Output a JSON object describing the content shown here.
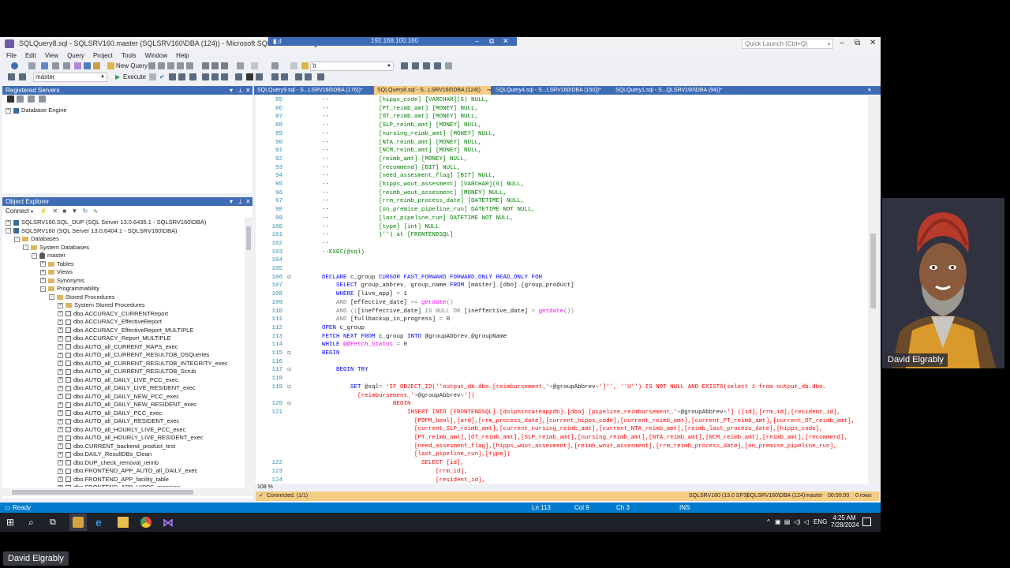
{
  "window": {
    "title": "SQLQuery8.sql - SQLSRV160.master (SQLSRV160\\DBA (124)) - Microsoft SQL Server Management Studio",
    "remote_ip": "192.168.100.160",
    "quick_launch_placeholder": "Quick Launch (Ctrl+Q)"
  },
  "menu": [
    "File",
    "Edit",
    "View",
    "Query",
    "Project",
    "Tools",
    "Window",
    "Help"
  ],
  "toolbar": {
    "new_query": "New Query",
    "execute": "Execute",
    "database": "master",
    "search_box": "\\t"
  },
  "registered_servers": {
    "title": "Registered Servers",
    "items": [
      {
        "label": "Database Engine"
      }
    ]
  },
  "object_explorer": {
    "title": "Object Explorer",
    "connect": "Connect",
    "servers": [
      {
        "label": "SQLSRV160.SQL_DUP (SQL Server 13.0.6435.1 - SQLSRV160\\DBA)"
      },
      {
        "label": "SQLSRV160 (SQL Server 13.0.6404.1 - SQLSRV160\\DBA)"
      }
    ],
    "tree": [
      {
        "label": "Databases",
        "level": 1,
        "type": "folder",
        "exp": "-"
      },
      {
        "label": "System Databases",
        "level": 2,
        "type": "folder",
        "exp": "-"
      },
      {
        "label": "master",
        "level": 3,
        "type": "db",
        "exp": "-"
      },
      {
        "label": "Tables",
        "level": 4,
        "type": "folder",
        "exp": "+"
      },
      {
        "label": "Views",
        "level": 4,
        "type": "folder",
        "exp": "+"
      },
      {
        "label": "Synonyms",
        "level": 4,
        "type": "folder",
        "exp": "+"
      },
      {
        "label": "Programmability",
        "level": 4,
        "type": "folder",
        "exp": "-"
      },
      {
        "label": "Stored Procedures",
        "level": 5,
        "type": "folder",
        "exp": "-"
      },
      {
        "label": "System Stored Procedures",
        "level": 6,
        "type": "folder",
        "exp": "+"
      },
      {
        "label": "dbo.ACCURACY_CURRENTReport",
        "level": 6,
        "type": "proc",
        "exp": "+"
      },
      {
        "label": "dbo.ACCURACY_EffectiveReport",
        "level": 6,
        "type": "proc",
        "exp": "+"
      },
      {
        "label": "dbo.ACCURACY_EffectiveReport_MULTIPLE",
        "level": 6,
        "type": "proc",
        "exp": "+"
      },
      {
        "label": "dbo.ACCURACY_Report_MULTIPLE",
        "level": 6,
        "type": "proc",
        "exp": "+"
      },
      {
        "label": "dbo.AUTO_all_CURRENT_RAPS_exec",
        "level": 6,
        "type": "proc",
        "exp": "+"
      },
      {
        "label": "dbo.AUTO_all_CURRENT_RESULTDB_DSQueries",
        "level": 6,
        "type": "proc",
        "exp": "+"
      },
      {
        "label": "dbo.AUTO_all_CURRENT_RESULTDB_INTEGRITY_exec",
        "level": 6,
        "type": "proc",
        "exp": "+"
      },
      {
        "label": "dbo.AUTO_all_CURRENT_RESULTDB_Scrub",
        "level": 6,
        "type": "proc",
        "exp": "+"
      },
      {
        "label": "dbo.AUTO_all_DAILY_LIVE_PCC_exec",
        "level": 6,
        "type": "proc",
        "exp": "+"
      },
      {
        "label": "dbo.AUTO_all_DAILY_LIVE_RESIDENT_exec",
        "level": 6,
        "type": "proc",
        "exp": "+"
      },
      {
        "label": "dbo.AUTO_all_DAILY_NEW_PCC_exec",
        "level": 6,
        "type": "proc",
        "exp": "+"
      },
      {
        "label": "dbo.AUTO_all_DAILY_NEW_RESIDENT_exec",
        "level": 6,
        "type": "proc",
        "exp": "+"
      },
      {
        "label": "dbo.AUTO_all_DAILY_PCC_exec",
        "level": 6,
        "type": "proc",
        "exp": "+"
      },
      {
        "label": "dbo.AUTO_all_DAILY_RESIDENT_exec",
        "level": 6,
        "type": "proc",
        "exp": "+"
      },
      {
        "label": "dbo.AUTO_all_HOURLY_LIVE_PCC_exec",
        "level": 6,
        "type": "proc",
        "exp": "+"
      },
      {
        "label": "dbo.AUTO_all_HOURLY_LIVE_RESIDENT_exec",
        "level": 6,
        "type": "proc",
        "exp": "+"
      },
      {
        "label": "dbo.CURRENT_backend_product_test",
        "level": 6,
        "type": "proc",
        "exp": "+"
      },
      {
        "label": "dbo.DAILY_ResultDBs_Clean",
        "level": 6,
        "type": "proc",
        "exp": "+"
      },
      {
        "label": "dbo.DUP_check_removal_reimb",
        "level": 6,
        "type": "proc",
        "exp": "+"
      },
      {
        "label": "dbo.FRONTEND_APP_AUTO_all_DAILY_exec",
        "level": 6,
        "type": "proc",
        "exp": "+"
      },
      {
        "label": "dbo.FRONTEND_APP_facility_table",
        "level": 6,
        "type": "proc",
        "exp": "+"
      },
      {
        "label": "dbo.FRONTEND_APP_HIPPS_mapping",
        "level": 6,
        "type": "proc",
        "exp": "+"
      }
    ]
  },
  "tabs": [
    {
      "label": "SQLQuery9.sql - S...LSRV160\\DBA (176))*",
      "active": false
    },
    {
      "label": "SQLQuery8.sql - S...LSRV160\\DBA (124))",
      "active": true
    },
    {
      "label": "SQLQuery4.sql - S...LSRV160\\DBA (150))*",
      "active": false
    },
    {
      "label": "SQLQuery1.sql - S...QLSRV160\\DBA (94))*",
      "active": false
    }
  ],
  "editor": {
    "zoom": "108 %",
    "lines": [
      {
        "n": "85",
        "segs": [
          [
            "cm",
            "        --              [hipps_code] [VARCHAR](6) NULL,"
          ]
        ]
      },
      {
        "n": "86",
        "segs": [
          [
            "cm",
            "        --              [PT_reimb_amt] [MONEY] NULL,"
          ]
        ]
      },
      {
        "n": "87",
        "segs": [
          [
            "cm",
            "        --              [OT_reimb_amt] [MONEY] NULL,"
          ]
        ]
      },
      {
        "n": "88",
        "segs": [
          [
            "cm",
            "        --              [SLP_reimb_amt] [MONEY] NULL,"
          ]
        ]
      },
      {
        "n": "89",
        "segs": [
          [
            "cm",
            "        --              [nursing_reimb_amt] [MONEY] NULL,"
          ]
        ]
      },
      {
        "n": "90",
        "segs": [
          [
            "cm",
            "        --              [NTA_reimb_amt] [MONEY] NULL,"
          ]
        ]
      },
      {
        "n": "91",
        "segs": [
          [
            "cm",
            "        --              [NCM_reimb_amt] [MONEY] NULL,"
          ]
        ]
      },
      {
        "n": "92",
        "segs": [
          [
            "cm",
            "        --              [reimb_amt] [MONEY] NULL,"
          ]
        ]
      },
      {
        "n": "93",
        "segs": [
          [
            "cm",
            "        --              [recommend] [BIT] NULL,"
          ]
        ]
      },
      {
        "n": "94",
        "segs": [
          [
            "cm",
            "        --              [need_assesment_flag] [BIT] NULL,"
          ]
        ]
      },
      {
        "n": "95",
        "segs": [
          [
            "cm",
            "        --              [hipps_wout_assesment] [VARCHAR](6) NULL,"
          ]
        ]
      },
      {
        "n": "96",
        "segs": [
          [
            "cm",
            "        --              [reimb_wout_assesment] [MONEY] NULL,"
          ]
        ]
      },
      {
        "n": "97",
        "segs": [
          [
            "cm",
            "        --              [rrm_reimb_process_date] [DATETIME] NULL,"
          ]
        ]
      },
      {
        "n": "98",
        "segs": [
          [
            "cm",
            "        --              [on_premise_pipeline_run] DATETIME NOT NULL,"
          ]
        ]
      },
      {
        "n": "99",
        "segs": [
          [
            "cm",
            "        --              [last_pipeline_run] DATETIME NOT NULL,"
          ]
        ]
      },
      {
        "n": "100",
        "segs": [
          [
            "cm",
            "        --              [type] [int] NULL"
          ]
        ]
      },
      {
        "n": "101",
        "segs": [
          [
            "cm",
            "        --              )'') at [FRONTENDSQL]"
          ]
        ]
      },
      {
        "n": "102",
        "segs": [
          [
            "cm",
            "        --"
          ]
        ]
      },
      {
        "n": "103",
        "segs": [
          [
            "cm",
            "        --EXEC(@sql)"
          ]
        ]
      },
      {
        "n": "104",
        "segs": [
          [
            "tx",
            ""
          ]
        ]
      },
      {
        "n": "105",
        "segs": [
          [
            "tx",
            ""
          ]
        ]
      },
      {
        "n": "106",
        "segs": [
          [
            "kw",
            "        DECLARE "
          ],
          [
            "tx",
            "c_group "
          ],
          [
            "kw",
            "CURSOR FAST_FORWARD FORWARD_ONLY READ_ONLY FOR"
          ]
        ]
      },
      {
        "n": "107",
        "segs": [
          [
            "kw",
            "            SELECT "
          ],
          [
            "tx",
            "group_abbrev"
          ],
          [
            "gr",
            ", "
          ],
          [
            "tx",
            "group_name "
          ],
          [
            "kw",
            "FROM "
          ],
          [
            "tx",
            "[master]"
          ],
          [
            "gr",
            "."
          ],
          [
            "tx",
            "[dbo]"
          ],
          [
            "gr",
            "."
          ],
          [
            "tx",
            "[group_product]"
          ]
        ]
      },
      {
        "n": "108",
        "segs": [
          [
            "kw",
            "            WHERE "
          ],
          [
            "tx",
            "[live_app] "
          ],
          [
            "gr",
            "= "
          ],
          [
            "tx",
            "1"
          ]
        ]
      },
      {
        "n": "109",
        "segs": [
          [
            "gr",
            "            AND "
          ],
          [
            "tx",
            "[effective_date] "
          ],
          [
            "gr",
            "<= "
          ],
          [
            "fn",
            "getdate"
          ],
          [
            "gr",
            "()"
          ]
        ]
      },
      {
        "n": "110",
        "segs": [
          [
            "gr",
            "            AND "
          ],
          [
            "gr",
            "(("
          ],
          [
            "tx",
            "[ineffective_date] "
          ],
          [
            "gr",
            "IS NULL OR "
          ],
          [
            "tx",
            "[ineffective_date] "
          ],
          [
            "gr",
            "> "
          ],
          [
            "fn",
            "getdate"
          ],
          [
            "gr",
            "())"
          ]
        ]
      },
      {
        "n": "111",
        "segs": [
          [
            "gr",
            "            AND "
          ],
          [
            "tx",
            "[fullbackup_in_progress] "
          ],
          [
            "gr",
            "= "
          ],
          [
            "tx",
            "0"
          ]
        ]
      },
      {
        "n": "112",
        "segs": [
          [
            "kw",
            "        OPEN "
          ],
          [
            "tx",
            "c_group"
          ]
        ]
      },
      {
        "n": "113",
        "segs": [
          [
            "kw",
            "        FETCH NEXT FROM "
          ],
          [
            "tx",
            "c_group "
          ],
          [
            "kw",
            "INTO "
          ],
          [
            "tx",
            "@groupAbbrev"
          ],
          [
            "gr",
            ","
          ],
          [
            "tx",
            "@groupName"
          ]
        ]
      },
      {
        "n": "114",
        "segs": [
          [
            "kw",
            "        WHILE "
          ],
          [
            "fn",
            "@@Fetch_Status "
          ],
          [
            "gr",
            "= "
          ],
          [
            "tx",
            "0"
          ]
        ]
      },
      {
        "n": "115",
        "segs": [
          [
            "kw",
            "        BEGIN"
          ]
        ]
      },
      {
        "n": "116",
        "segs": [
          [
            "tx",
            ""
          ]
        ]
      },
      {
        "n": "117",
        "segs": [
          [
            "kw",
            "            BEGIN TRY"
          ]
        ]
      },
      {
        "n": "118",
        "segs": [
          [
            "tx",
            ""
          ]
        ]
      },
      {
        "n": "119",
        "segs": [
          [
            "kw",
            "                SET "
          ],
          [
            "tx",
            "@sql"
          ],
          [
            "gr",
            "= "
          ],
          [
            "st",
            "'IF OBJECT_ID(''output_db.dbo.[reimbursement_'"
          ],
          [
            "gr",
            "+"
          ],
          [
            "tx",
            "@groupAbbrev"
          ],
          [
            "gr",
            "+"
          ],
          [
            "st",
            "']'', ''U'') IS NOT NULL AND EXISTS(select 1 from output_db.dbo."
          ]
        ]
      },
      {
        "n": "",
        "segs": [
          [
            "st",
            "                  [reimbursement_'"
          ],
          [
            "gr",
            "+"
          ],
          [
            "tx",
            "@groupAbbrev"
          ],
          [
            "gr",
            "+"
          ],
          [
            "st",
            "'])"
          ]
        ]
      },
      {
        "n": "120",
        "segs": [
          [
            "st",
            "                            BEGIN"
          ]
        ]
      },
      {
        "n": "121",
        "segs": [
          [
            "st",
            "                                INSERT INTO [FRONTENDSQL].[dolphincareappdb].[dbo].[pipeline_reimbursement_'"
          ],
          [
            "gr",
            "+"
          ],
          [
            "tx",
            "@groupAbbrev"
          ],
          [
            "gr",
            "+"
          ],
          [
            "st",
            "'] ([id],[rrm_id],[resident_id],"
          ]
        ]
      },
      {
        "n": "",
        "segs": [
          [
            "st",
            "                                  [PDPM_bool],[ard],[rrm_process_date],[current_hipps_code],[current_reimb_amt],[current_PT_reimb_amt],[current_OT_reimb_amt],"
          ]
        ]
      },
      {
        "n": "",
        "segs": [
          [
            "st",
            "                                  [current_SLP_reimb_amt],[current_nursing_reimb_amt],[current_NTA_reimb_amt],[reimb_last_process_date],[hipps_code],"
          ]
        ]
      },
      {
        "n": "",
        "segs": [
          [
            "st",
            "                                  [PT_reimb_amt],[OT_reimb_amt],[SLP_reimb_amt],[nursing_reimb_amt],[NTA_reimb_amt],[NCM_reimb_amt],[reimb_amt],[recommend],"
          ]
        ]
      },
      {
        "n": "",
        "segs": [
          [
            "st",
            "                                  [need_assesment_flag],[hipps_wout_assesment],[reimb_wout_assesment],[rrm_reimb_process_date],[on_premise_pipeline_run],"
          ]
        ]
      },
      {
        "n": "",
        "segs": [
          [
            "st",
            "                                  [last_pipeline_run],[type])"
          ]
        ]
      },
      {
        "n": "122",
        "segs": [
          [
            "st",
            "                                    SELECT [id],"
          ]
        ]
      },
      {
        "n": "123",
        "segs": [
          [
            "st",
            "                                        [rrm_id],"
          ]
        ]
      },
      {
        "n": "124",
        "segs": [
          [
            "st",
            "                                        [resident_id],"
          ]
        ]
      }
    ]
  },
  "status_strip": {
    "connection": "Connected. (1/1)",
    "server": "SQLSRV160 (13.0 SP3)",
    "user": "SQLSRV160\\DBA (124)",
    "database": "master",
    "elapsed": "00:00:00",
    "rows": "0 rows"
  },
  "statusbar": {
    "ready": "Ready",
    "ln": "Ln 113",
    "col": "Col 9",
    "ch": "Ch 3",
    "ins": "INS"
  },
  "taskbar": {
    "lang": "ENG",
    "time": "4:25 AM",
    "date": "7/28/2024"
  },
  "presenter": {
    "name": "David Elgrably"
  },
  "colors": {
    "accent": "#007acc",
    "panel_header": "#3e6db5",
    "active_tab": "#f5cc84"
  }
}
